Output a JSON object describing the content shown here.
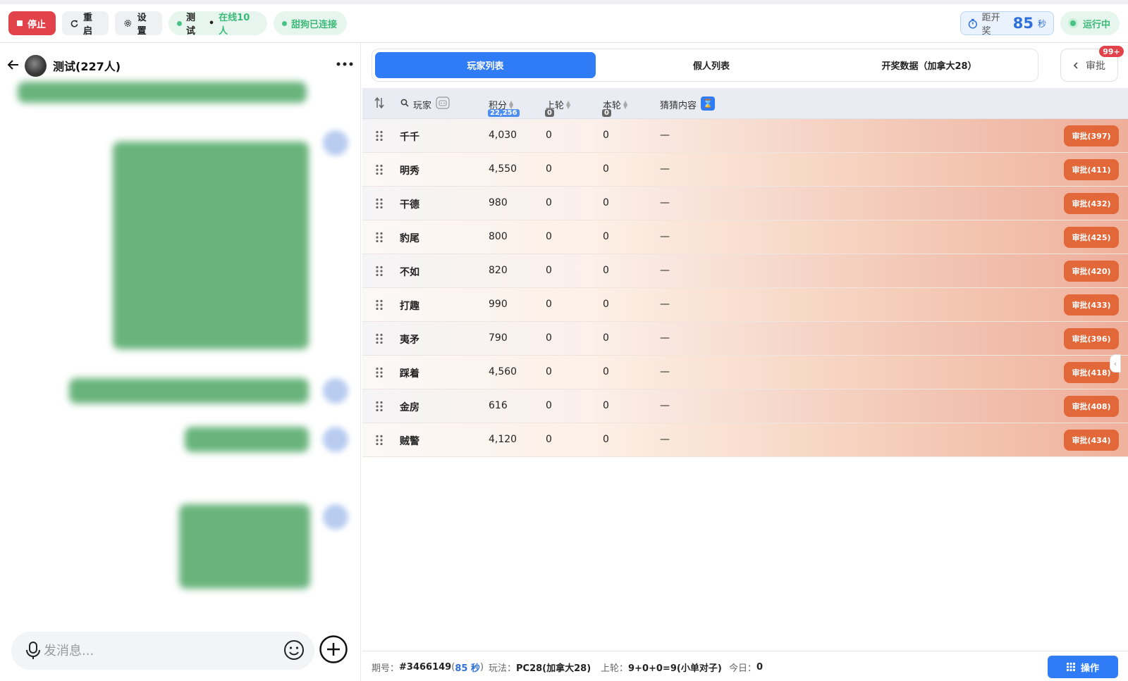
{
  "topbar": {
    "stop_label": "停止",
    "restart_label": "重启",
    "settings_label": "设置",
    "room_name": "测试",
    "room_sep": "•",
    "online_text": "在线10人",
    "connection_text": "甜狗已连接",
    "countdown_label": "距开奖",
    "countdown_value": "85",
    "countdown_unit": "秒",
    "running_text": "运行中"
  },
  "chat": {
    "title": "测试(227人)",
    "input_placeholder": "发消息..."
  },
  "tabs": {
    "items": [
      {
        "label": "玩家列表",
        "active": true
      },
      {
        "label": "假人列表",
        "active": false
      },
      {
        "label": "开奖数据（加拿大28）",
        "active": false
      }
    ],
    "approve_label": "审批",
    "approve_badge": "99+"
  },
  "table": {
    "headers": {
      "player": "玩家",
      "score": "积分",
      "score_total": "22,256",
      "last_round": "上轮",
      "last_round_total": "0",
      "this_round": "本轮",
      "this_round_total": "0",
      "guess": "猜猜内容"
    },
    "rows": [
      {
        "name": "千千",
        "score": "4,030",
        "last": "0",
        "current": "0",
        "guess": "—",
        "action": "审批(397)"
      },
      {
        "name": "明秀",
        "score": "4,550",
        "last": "0",
        "current": "0",
        "guess": "—",
        "action": "审批(411)"
      },
      {
        "name": "干德",
        "score": "980",
        "last": "0",
        "current": "0",
        "guess": "—",
        "action": "审批(432)"
      },
      {
        "name": "豹尾",
        "score": "800",
        "last": "0",
        "current": "0",
        "guess": "—",
        "action": "审批(425)"
      },
      {
        "name": "不如",
        "score": "820",
        "last": "0",
        "current": "0",
        "guess": "—",
        "action": "审批(420)"
      },
      {
        "name": "打趣",
        "score": "990",
        "last": "0",
        "current": "0",
        "guess": "—",
        "action": "审批(433)"
      },
      {
        "name": "夷矛",
        "score": "790",
        "last": "0",
        "current": "0",
        "guess": "—",
        "action": "审批(396)"
      },
      {
        "name": "踩着",
        "score": "4,560",
        "last": "0",
        "current": "0",
        "guess": "—",
        "action": "审批(418)"
      },
      {
        "name": "金房",
        "score": "616",
        "last": "0",
        "current": "0",
        "guess": "—",
        "action": "审批(408)"
      },
      {
        "name": "贼警",
        "score": "4,120",
        "last": "0",
        "current": "0",
        "guess": "—",
        "action": "审批(434)"
      }
    ]
  },
  "footer": {
    "period_label": "期号：",
    "period_value": "#3466149",
    "period_countdown": "85 秒",
    "play_label": "玩法：",
    "play_value": "PC28(加拿大28)",
    "last_label": "上轮：",
    "last_value": "9+0+0=9(小单对子)",
    "today_label": "今日：",
    "today_value": "0",
    "operate_label": "操作"
  },
  "colors": {
    "primary": "#2f7cf6",
    "danger": "#e2434a",
    "approve": "#e2683a",
    "success": "#3cb878"
  },
  "icons": [
    "stop-icon",
    "refresh-icon",
    "gear-icon",
    "timer-icon",
    "back-arrow-icon",
    "more-icon",
    "mic-icon",
    "emoji-icon",
    "plus-circle-icon",
    "sort-icon",
    "search-icon",
    "robot-icon",
    "hourglass-icon",
    "drag-handle-icon",
    "chevron-left-icon",
    "grid-icon"
  ]
}
